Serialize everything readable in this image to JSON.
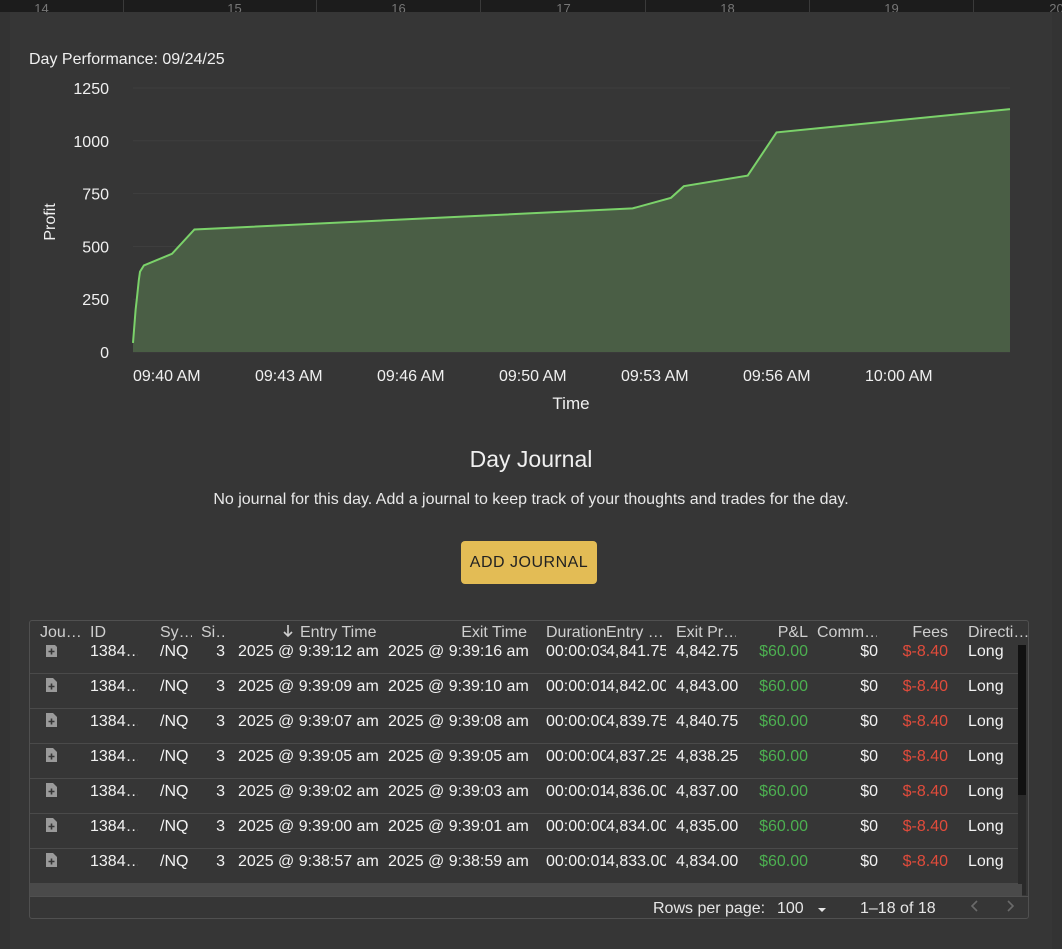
{
  "top_strip": {
    "labels": [
      "14",
      "15",
      "16",
      "17",
      "18",
      "19",
      "20"
    ]
  },
  "chart_title": "Day Performance: 09/24/25",
  "chart_data": {
    "type": "area",
    "title": "Day Performance: 09/24/25",
    "xlabel": "Time",
    "ylabel": "Profit",
    "ylim": [
      0,
      1250
    ],
    "yticks": [
      0,
      250,
      500,
      750,
      1000,
      1250
    ],
    "xticks": [
      "09:40 AM",
      "09:43 AM",
      "09:46 AM",
      "09:50 AM",
      "09:53 AM",
      "09:56 AM",
      "10:00 AM"
    ],
    "grid": true,
    "line_color": "#7bd26a",
    "fill_color": "#4a5e45",
    "points": [
      {
        "t": "09:38:59",
        "y": 43
      },
      {
        "t": "09:39:03",
        "y": 200
      },
      {
        "t": "09:39:05",
        "y": 250
      },
      {
        "t": "09:39:08",
        "y": 340
      },
      {
        "t": "09:39:10",
        "y": 380
      },
      {
        "t": "09:39:16",
        "y": 410
      },
      {
        "t": "09:40:00",
        "y": 465
      },
      {
        "t": "09:40:35",
        "y": 580
      },
      {
        "t": "09:52:00",
        "y": 680
      },
      {
        "t": "09:53:00",
        "y": 730
      },
      {
        "t": "09:53:20",
        "y": 785
      },
      {
        "t": "09:55:00",
        "y": 835
      },
      {
        "t": "09:55:45",
        "y": 1040
      },
      {
        "t": "10:01:50",
        "y": 1150
      }
    ]
  },
  "journal": {
    "title": "Day Journal",
    "message": "No journal for this day. Add a journal to keep track of your thoughts and trades for the day.",
    "add_button": "ADD JOURNAL"
  },
  "table": {
    "headers": {
      "journal": "Jou…",
      "id": "ID",
      "symbol": "Sy…",
      "size": "Si…",
      "entry_time": "Entry Time",
      "exit_time": "Exit Time",
      "duration": "Duration",
      "entry_price": "Entry …",
      "exit_price": "Exit Pr…",
      "pnl": "P&L",
      "commission": "Comm…",
      "fees": "Fees",
      "direction": "Directi…"
    },
    "sort_icon": "arrow-down",
    "rows": [
      {
        "id": "1384…",
        "symbol": "/NQ",
        "size": "3",
        "entry_time": "2025 @ 9:39:12 am",
        "exit_time": "2025 @ 9:39:16 am",
        "duration": "00:00:03",
        "entry_price": "4,841.75",
        "exit_price": "4,842.75",
        "pnl": "$60.00",
        "commission": "$0",
        "fees": "$-8.40",
        "direction": "Long"
      },
      {
        "id": "1384…",
        "symbol": "/NQ",
        "size": "3",
        "entry_time": "2025 @ 9:39:09 am",
        "exit_time": "2025 @ 9:39:10 am",
        "duration": "00:00:01",
        "entry_price": "4,842.00",
        "exit_price": "4,843.00",
        "pnl": "$60.00",
        "commission": "$0",
        "fees": "$-8.40",
        "direction": "Long"
      },
      {
        "id": "1384…",
        "symbol": "/NQ",
        "size": "3",
        "entry_time": "2025 @ 9:39:07 am",
        "exit_time": "2025 @ 9:39:08 am",
        "duration": "00:00:00",
        "entry_price": "4,839.75",
        "exit_price": "4,840.75",
        "pnl": "$60.00",
        "commission": "$0",
        "fees": "$-8.40",
        "direction": "Long"
      },
      {
        "id": "1384…",
        "symbol": "/NQ",
        "size": "3",
        "entry_time": "2025 @ 9:39:05 am",
        "exit_time": "2025 @ 9:39:05 am",
        "duration": "00:00:00",
        "entry_price": "4,837.25",
        "exit_price": "4,838.25",
        "pnl": "$60.00",
        "commission": "$0",
        "fees": "$-8.40",
        "direction": "Long"
      },
      {
        "id": "1384…",
        "symbol": "/NQ",
        "size": "3",
        "entry_time": "2025 @ 9:39:02 am",
        "exit_time": "2025 @ 9:39:03 am",
        "duration": "00:00:01",
        "entry_price": "4,836.00",
        "exit_price": "4,837.00",
        "pnl": "$60.00",
        "commission": "$0",
        "fees": "$-8.40",
        "direction": "Long"
      },
      {
        "id": "1384…",
        "symbol": "/NQ",
        "size": "3",
        "entry_time": "2025 @ 9:39:00 am",
        "exit_time": "2025 @ 9:39:01 am",
        "duration": "00:00:00",
        "entry_price": "4,834.00",
        "exit_price": "4,835.00",
        "pnl": "$60.00",
        "commission": "$0",
        "fees": "$-8.40",
        "direction": "Long"
      },
      {
        "id": "1384…",
        "symbol": "/NQ",
        "size": "3",
        "entry_time": "2025 @ 9:38:57 am",
        "exit_time": "2025 @ 9:38:59 am",
        "duration": "00:00:01",
        "entry_price": "4,833.00",
        "exit_price": "4,834.00",
        "pnl": "$60.00",
        "commission": "$0",
        "fees": "$-8.40",
        "direction": "Long"
      }
    ]
  },
  "pagination": {
    "rows_per_page_label": "Rows per page:",
    "rows_per_page_value": "100",
    "range_text": "1–18 of 18"
  }
}
